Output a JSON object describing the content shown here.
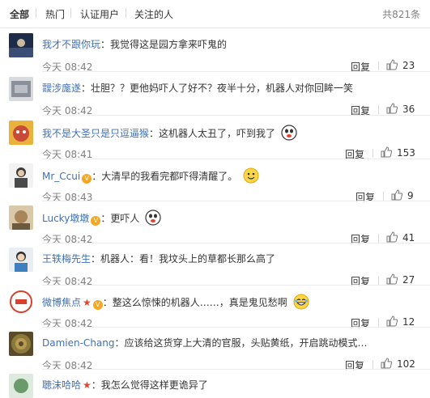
{
  "tabs": {
    "all": "全部",
    "hot": "热门",
    "verified": "认证用户",
    "following": "关注的人"
  },
  "total": "共821条",
  "reply_label": "回复",
  "comments": [
    {
      "user": "我才不跟你玩",
      "text": "：我觉得这是园方拿来吓鬼的",
      "time": "今天 08:42",
      "likes": "23",
      "avatar_color": "#2a3a5c"
    },
    {
      "user": "靉涉庬遂",
      "text": "：壮胆？？更他妈吓人了好不？夜半十分，机器人对你回眸一笑",
      "time": "今天 08:42",
      "likes": "36",
      "avatar_color": "#8a8f9a"
    },
    {
      "user": "我不是大圣只是只逗逼猴",
      "text": "：这机器人太丑了，吓到我了",
      "time": "今天 08:41",
      "likes": "153",
      "avatar_color": "#c94a36"
    },
    {
      "user": "Mr_Ccui",
      "text": "：大清早的我看完都吓得清醒了。",
      "time": "今天 08:43",
      "likes": "9",
      "avatar_color": "#4a4a4a"
    },
    {
      "user": "Lucky墩墩",
      "text": "：更吓人",
      "time": "今天 08:42",
      "likes": "41",
      "avatar_color": "#a8865a"
    },
    {
      "user": "王轶梅先生",
      "text": "：机器人：看！我坟头上的草都长那么高了",
      "time": "今天 08:42",
      "likes": "27",
      "avatar_color": "#3f7fbf"
    },
    {
      "user": "微博焦点",
      "text": "：整这么惊悚的机器人……，真是鬼见愁啊",
      "time": "今天 08:42",
      "likes": "12",
      "avatar_color": "#d9412f"
    },
    {
      "user": "Damien-Chang",
      "text": "：应该给这货穿上大清的官服，头贴黄纸，开启跳动模式…",
      "time": "今天 08:42",
      "likes": "102",
      "avatar_color": "#8c7a3c"
    },
    {
      "user": "聴沫哈哈",
      "text": "：我怎么觉得这样更诡异了",
      "time": "",
      "likes": "",
      "avatar_color": "#6a9a6a"
    }
  ],
  "colors": {
    "name": "#eb7350",
    "link": "#4070b8",
    "meta": "#808080",
    "badge": "#f5a623"
  },
  "icons": {
    "like": "thumb-up-icon",
    "verified": "verified-badge-icon",
    "star": "star-icon",
    "emoji": "emoji-icon"
  }
}
